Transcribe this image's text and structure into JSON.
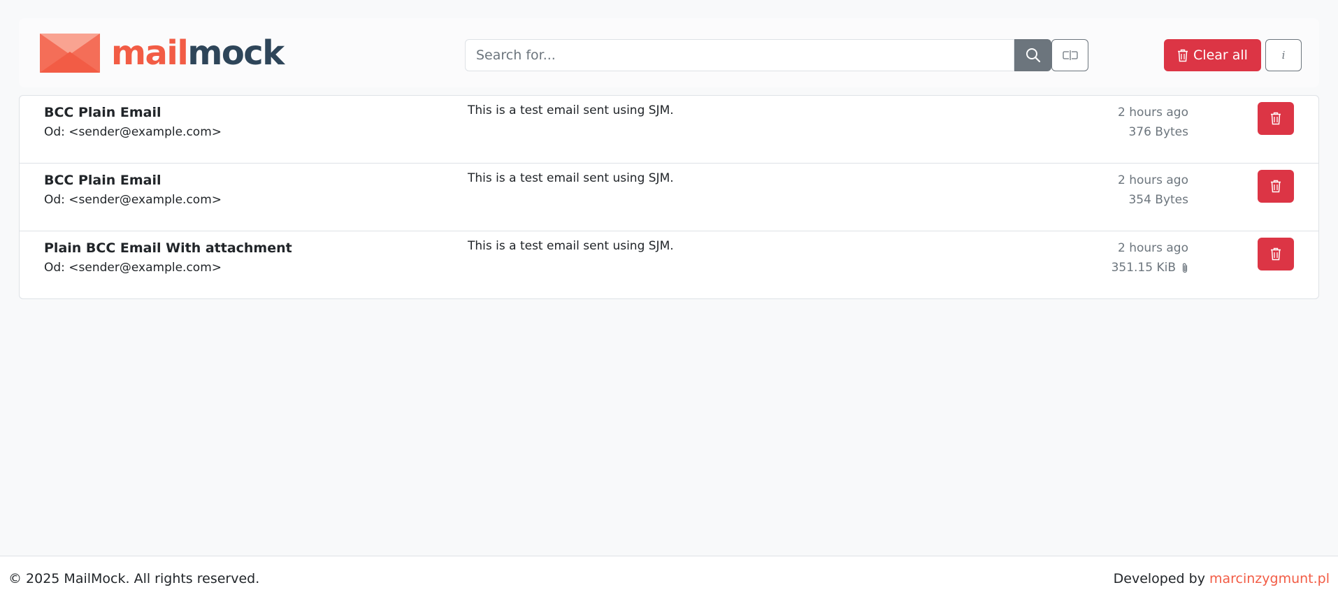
{
  "brand": {
    "name_part1": "mail",
    "name_part2": "mock",
    "colors": {
      "accent": "#f25c45",
      "dark": "#2e4559",
      "danger": "#dc3545",
      "secondary": "#6c757d"
    }
  },
  "header": {
    "search_placeholder": "Search for...",
    "search_icon": "search-icon",
    "toggle_icon": "text-cursor-icon",
    "clear_all_label": "Clear all",
    "info_label": "i"
  },
  "emails": [
    {
      "subject": "BCC Plain Email",
      "from": "Od: <sender@example.com>",
      "preview": "This is a test email sent using SJM.",
      "time": "2 hours ago",
      "size": "376 Bytes",
      "has_attachment": false
    },
    {
      "subject": "BCC Plain Email",
      "from": "Od: <sender@example.com>",
      "preview": "This is a test email sent using SJM.",
      "time": "2 hours ago",
      "size": "354 Bytes",
      "has_attachment": false
    },
    {
      "subject": "Plain BCC Email With attachment",
      "from": "Od: <sender@example.com>",
      "preview": "This is a test email sent using SJM.",
      "time": "2 hours ago",
      "size": "351.15 KiB",
      "has_attachment": true
    }
  ],
  "footer": {
    "copyright": "© 2025 MailMock. All rights reserved.",
    "developed_by": "Developed by",
    "developer_link": "marcinzygmunt.pl"
  }
}
